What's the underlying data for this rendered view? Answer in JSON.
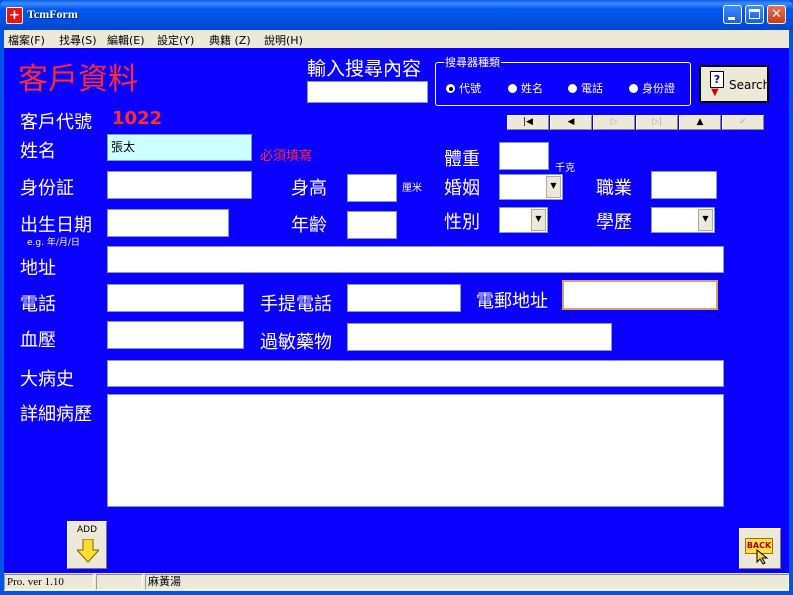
{
  "window": {
    "title": "TcmForm"
  },
  "menu": [
    "檔案(F)",
    "找尋(S)",
    "編輯(E)",
    "設定(Y)",
    "典籍 (Z)",
    "說明(H)"
  ],
  "form": {
    "heading": "客戶資料",
    "search": {
      "label": "輸入搜尋內容",
      "value": "",
      "group_title": "搜尋器種類",
      "options": [
        "代號",
        "姓名",
        "電話",
        "身份證"
      ],
      "selected": "代號",
      "button_label": "Search"
    },
    "customer_id": {
      "label": "客戶代號",
      "value": "1022"
    },
    "name": {
      "label": "姓名",
      "value": "張太",
      "required_note": "必須填寫"
    },
    "id_card": {
      "label": "身份証",
      "value": ""
    },
    "birth": {
      "label": "出生日期",
      "hint": "e.g. 年/月/日",
      "value": ""
    },
    "height": {
      "label": "身高",
      "unit": "厘米",
      "value": ""
    },
    "age": {
      "label": "年齡",
      "value": ""
    },
    "weight": {
      "label": "體重",
      "unit": "千克",
      "value": ""
    },
    "marital": {
      "label": "婚姻",
      "value": ""
    },
    "sex": {
      "label": "性別",
      "value": ""
    },
    "occupation": {
      "label": "職業",
      "value": ""
    },
    "education": {
      "label": "學歷",
      "value": ""
    },
    "address": {
      "label": "地址",
      "value": ""
    },
    "phone": {
      "label": "電話",
      "value": ""
    },
    "mobile": {
      "label": "手提電話",
      "value": ""
    },
    "email": {
      "label": "電郵地址",
      "value": ""
    },
    "blood_pressure": {
      "label": "血壓",
      "value": ""
    },
    "allergy": {
      "label": "過敏藥物",
      "value": ""
    },
    "major_illness": {
      "label": "大病史",
      "value": ""
    },
    "history": {
      "label": "詳細病歷",
      "value": ""
    },
    "add_label": "ADD",
    "back_label": "BACK"
  },
  "nav": {
    "first": "|◀",
    "prev": "◀",
    "next": "▷",
    "last": "▷|",
    "up": "▲",
    "check": "✓"
  },
  "status": {
    "version": "Pro. ver 1.10",
    "middle": "",
    "user": "麻黃湯"
  },
  "colors": {
    "heading": "#ff2a2a",
    "customer_id": "#ff2a2a",
    "required": "#ff2a2a",
    "client_bg": "#0a00ff",
    "name_field_bg": "#ccffff"
  }
}
